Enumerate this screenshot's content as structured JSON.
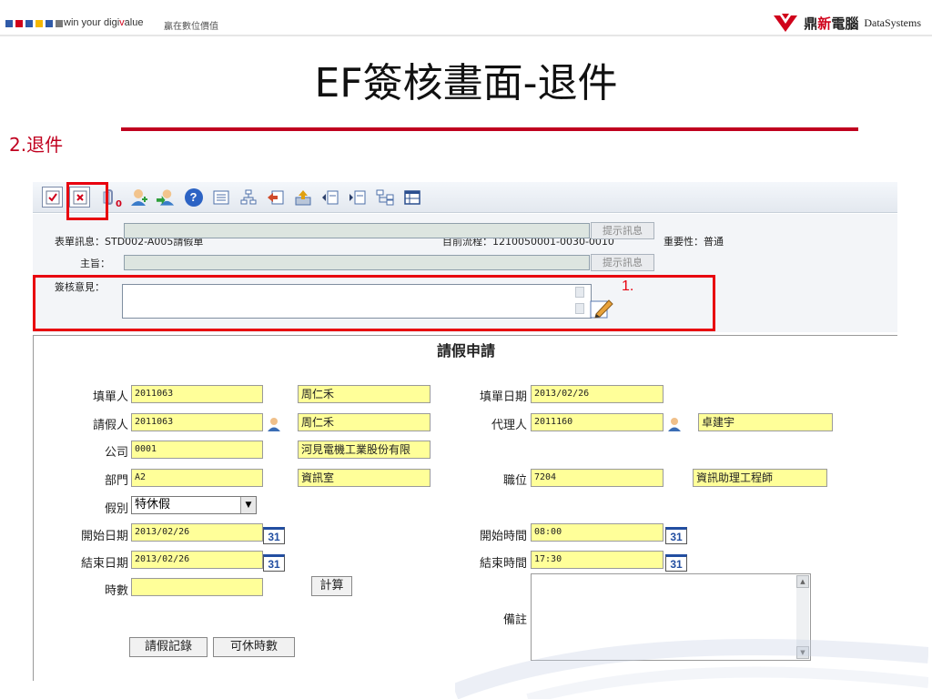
{
  "banner": {
    "tagline_pre": "win your digi",
    "tagline_post": "alue",
    "tagline_v": "v",
    "tagline_cn": "贏在數位價值",
    "logo_cn_a": "鼎",
    "logo_cn_b": "新",
    "logo_cn_c": "電腦",
    "logo_en": "DataSystems",
    "square_colors": [
      "#2f5aa8",
      "#d0021b",
      "#2f5aa8",
      "#f5b800",
      "#2f5aa8",
      "#7a7a7a"
    ]
  },
  "slide": {
    "title": "EF簽核畫面-退件",
    "subtitle": "2.退件",
    "accent_color": "#c0001f"
  },
  "annotation": {
    "marker": "1."
  },
  "toolbar": {
    "icons": [
      "approve-icon",
      "reject-icon",
      "attachment-icon",
      "add-signer-icon",
      "transfer-icon",
      "help-icon",
      "form-view-icon",
      "flow-chart-icon",
      "return-icon",
      "upload-icon",
      "prev-page-icon",
      "next-page-icon",
      "org-chart-icon",
      "grid-icon"
    ],
    "attachment_count": "0"
  },
  "info": {
    "form_info_label": "表單訊息：",
    "form_info_value": "STD002-A005請假單",
    "flow_label": "目前流程：",
    "flow_value": "1210050001-0030-0010",
    "importance_label": "重要性：",
    "importance_value": "普通",
    "subject_label": "主旨：",
    "hint_button": "提示訊息",
    "comment_label": "簽核意見："
  },
  "form": {
    "title": "請假申請",
    "filler_label": "填單人",
    "filler_id": "2011063",
    "filler_name": "周仁禾",
    "fill_date_label": "填單日期",
    "fill_date": "2013/02/26",
    "leave_person_label": "請假人",
    "leave_person_id": "2011063",
    "leave_person_name": "周仁禾",
    "agent_label": "代理人",
    "agent_id": "2011160",
    "agent_name": "卓建宇",
    "company_label": "公司",
    "company_id": "0001",
    "company_name": "河見電機工業股份有限",
    "dept_label": "部門",
    "dept_id": "A2",
    "dept_name": "資訊室",
    "position_label": "職位",
    "position_id": "7204",
    "position_name": "資訊助理工程師",
    "leave_type_label": "假別",
    "leave_type": "特休假",
    "start_date_label": "開始日期",
    "start_date": "2013/02/26",
    "start_time_label": "開始時間",
    "start_time": "08:00",
    "end_date_label": "結束日期",
    "end_date": "2013/02/26",
    "end_time_label": "結束時間",
    "end_time": "17:30",
    "hours_label": "時數",
    "hours_value": "",
    "calc_button": "計算",
    "memo_label": "備註",
    "leave_record_button": "請假記錄",
    "avail_hours_button": "可休時數",
    "calendar_day": "31"
  }
}
